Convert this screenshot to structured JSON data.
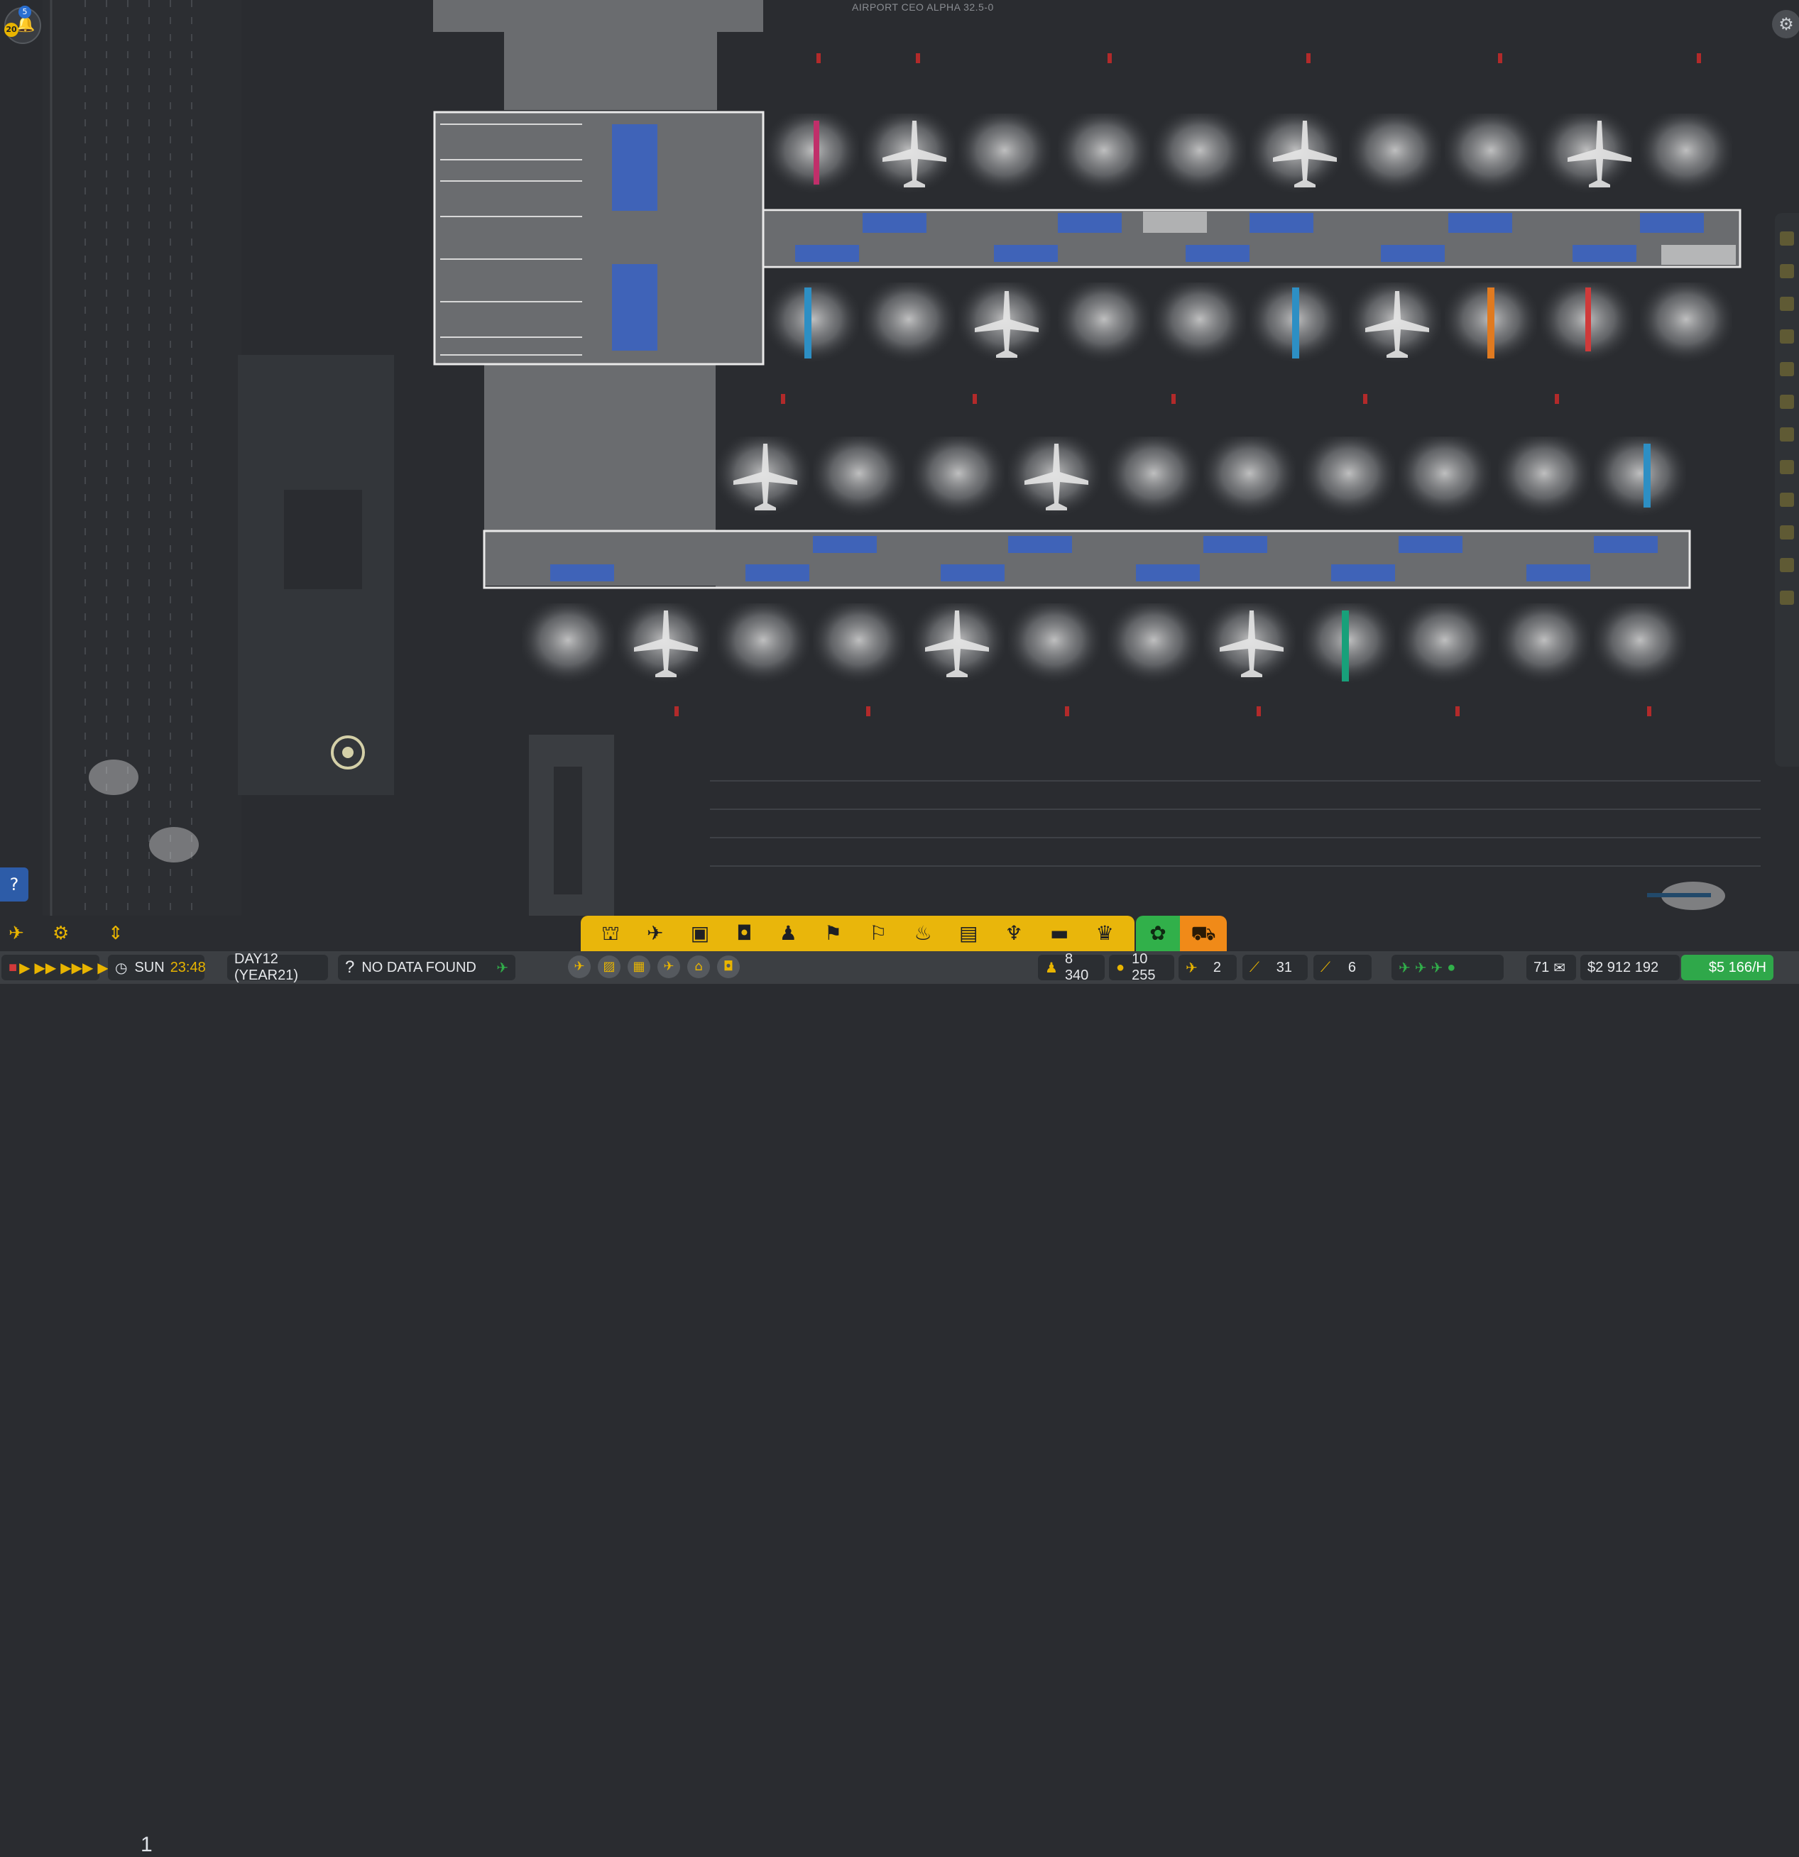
{
  "game": {
    "version_caption": "AIRPORT CEO ALPHA 32.5-0"
  },
  "notifications": {
    "badge_blue": "5",
    "badge_yellow": "20"
  },
  "help": {
    "label": "?"
  },
  "toolbar_top": {
    "floor_level": "1",
    "left_icons": [
      "plane-icon",
      "cog-icon",
      "floor-arrows-icon"
    ],
    "build_icons": [
      "terminal-icon",
      "aircraft-icon",
      "bus-icon",
      "baggage-icon",
      "staff-icon",
      "security-icon",
      "check-in-icon",
      "toilet-icon",
      "desk-icon",
      "food-icon",
      "seating-icon",
      "shop-icon"
    ],
    "green_icon": "zone-icon",
    "orange_icon": "vehicle-icon"
  },
  "status_bar": {
    "weekday": "SUN",
    "time": "23:48",
    "day": "DAY12 (YEAR21)",
    "no_data": "NO DATA FOUND",
    "passengers": "8 340",
    "staff": "10 255",
    "arrivals": "2",
    "stands": "31",
    "departures": "6",
    "mail_count": "71",
    "money": "$2 912 192",
    "rate": "$5 166/H",
    "accent_yellow": "#e8b400",
    "accent_green": "#2fa84a",
    "accent_orange": "#f08a18"
  },
  "map": {
    "stand_rows": [
      {
        "name": "row-a",
        "count": 10
      },
      {
        "name": "row-b",
        "count": 10
      },
      {
        "name": "row-c",
        "count": 10
      },
      {
        "name": "row-d",
        "count": 12
      }
    ]
  }
}
